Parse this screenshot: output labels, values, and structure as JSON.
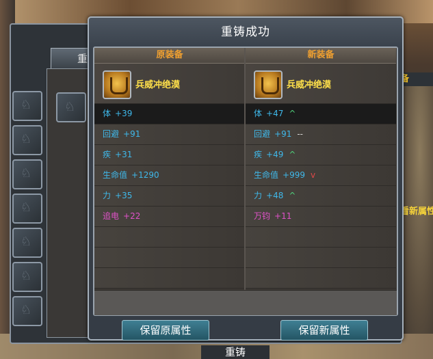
{
  "dialog": {
    "title": "重铸成功",
    "old_header": "原装备",
    "new_header": "新装备",
    "keep_old_label": "保留原属性",
    "keep_new_label": "保留新属性"
  },
  "old_item": {
    "name": "兵威冲绝漠",
    "icon": "golden-helmet-icon",
    "stats": [
      {
        "name": "体",
        "value": "+39",
        "color": "#3fb8ea",
        "selected": true
      },
      {
        "name": "回避",
        "value": "+91",
        "color": "#3fb8ea"
      },
      {
        "name": "疾",
        "value": "+31",
        "color": "#3fb8ea"
      },
      {
        "name": "生命值",
        "value": "+1290",
        "color": "#3fb8ea"
      },
      {
        "name": "力",
        "value": "+35",
        "color": "#3fb8ea"
      },
      {
        "name": "追电",
        "value": "+22",
        "color": "#e052c9"
      }
    ]
  },
  "new_item": {
    "name": "兵威冲绝漠",
    "icon": "golden-helmet-icon",
    "stats": [
      {
        "name": "体",
        "value": "+47",
        "indicator": "^",
        "trend": "up",
        "selected": true
      },
      {
        "name": "回避",
        "value": "+91",
        "indicator": "--",
        "trend": "same"
      },
      {
        "name": "疾",
        "value": "+49",
        "indicator": "^",
        "trend": "up"
      },
      {
        "name": "生命值",
        "value": "+999",
        "indicator": "v",
        "trend": "down"
      },
      {
        "name": "力",
        "value": "+48",
        "indicator": "^",
        "trend": "up"
      },
      {
        "name": "万钧",
        "value": "+11",
        "indicator": "",
        "trend": "none",
        "color": "#e052c9"
      }
    ]
  },
  "background_window": {
    "tab_label": "重",
    "right_label": "备",
    "right_hint": "看新属性",
    "bottom_button_label": "重铸"
  },
  "colors": {
    "gold_text": "#ffe04a",
    "header_text": "#f0a030",
    "stat_blue": "#3fb8ea",
    "stat_pink": "#e052c9",
    "trend_up": "#4fd07a",
    "trend_down": "#e04848"
  }
}
